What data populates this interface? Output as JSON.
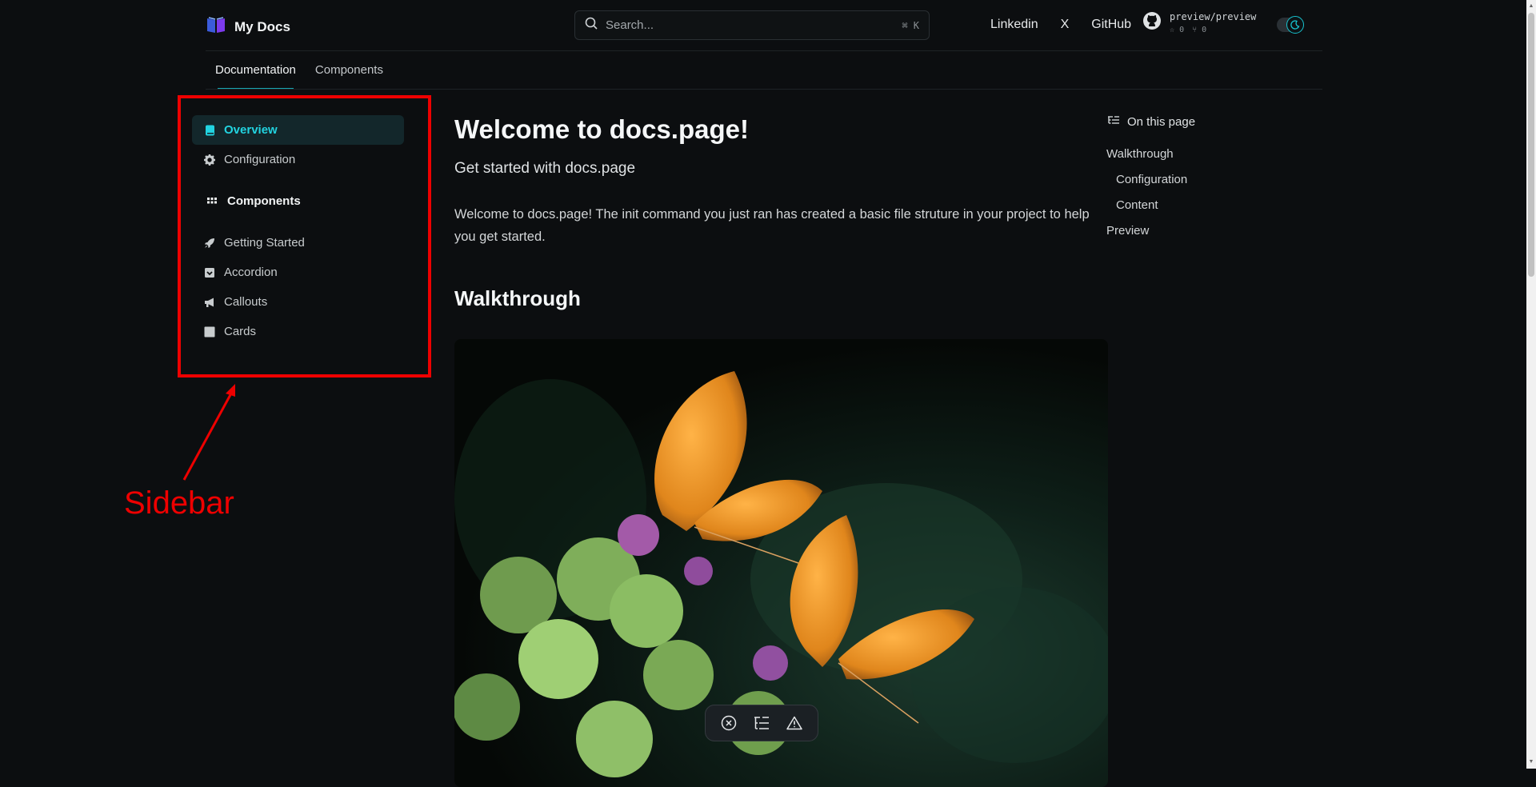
{
  "header": {
    "brand_title": "My Docs",
    "search_placeholder": "Search...",
    "search_shortcut": "⌘ K",
    "links": [
      "Linkedin",
      "X",
      "GitHub"
    ],
    "repo_name": "preview/preview",
    "repo_stars": "0",
    "repo_forks": "0"
  },
  "tabs": [
    {
      "label": "Documentation",
      "active": true
    },
    {
      "label": "Components",
      "active": false
    }
  ],
  "sidebar": {
    "items_top": [
      {
        "label": "Overview",
        "icon": "book-icon",
        "active": true
      },
      {
        "label": "Configuration",
        "icon": "gear-icon",
        "active": false
      }
    ],
    "group_label": "Components",
    "group_icon": "grid-icon",
    "items_group": [
      {
        "label": "Getting Started",
        "icon": "rocket-icon"
      },
      {
        "label": "Accordion",
        "icon": "inbox-icon"
      },
      {
        "label": "Callouts",
        "icon": "megaphone-icon"
      },
      {
        "label": "Cards",
        "icon": "square-icon"
      }
    ]
  },
  "main": {
    "title": "Welcome to docs.page!",
    "subtitle": "Get started with docs.page",
    "intro": "Welcome to docs.page! The init command you just ran has created a basic file struture in your project to help you get started.",
    "section_heading": "Walkthrough"
  },
  "toc": {
    "heading": "On this page",
    "items": [
      {
        "label": "Walkthrough",
        "level": 1
      },
      {
        "label": "Configuration",
        "level": 2
      },
      {
        "label": "Content",
        "level": 2
      },
      {
        "label": "Preview",
        "level": 1
      }
    ]
  },
  "annotation": {
    "label": "Sidebar",
    "color": "#ee0000"
  },
  "colors": {
    "accent": "#22d3e0",
    "background": "#0c0e10"
  }
}
